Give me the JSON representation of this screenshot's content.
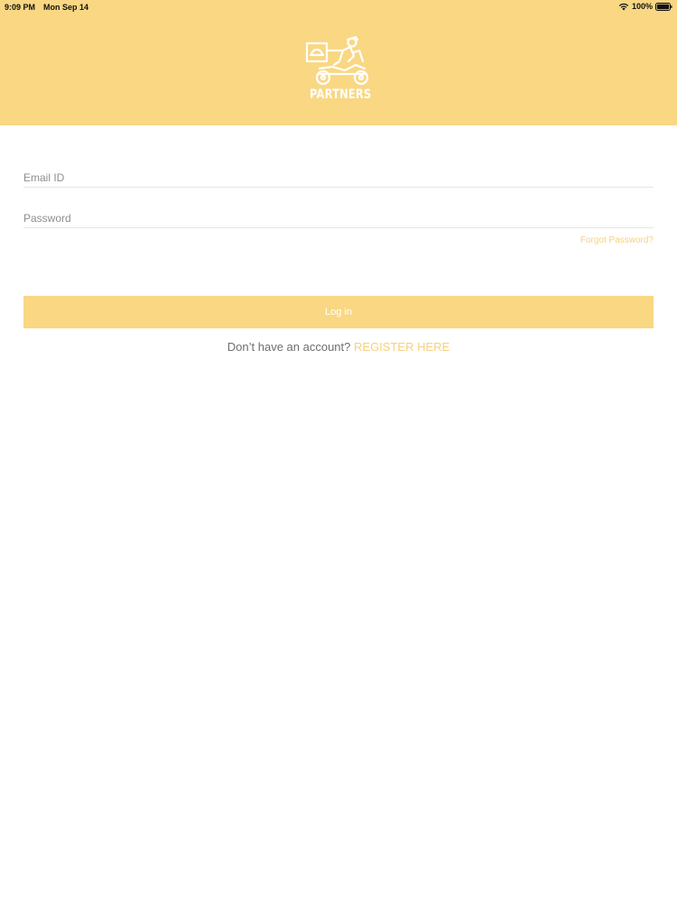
{
  "status_bar": {
    "time": "9:09 PM",
    "date": "Mon Sep 14",
    "battery": "100%",
    "icons": [
      "wifi-icon",
      "battery-icon"
    ]
  },
  "header": {
    "logo_text": "PARTNERS",
    "logo_icon": "delivery-scooter-icon",
    "background_color": "#f9d783"
  },
  "form": {
    "email_placeholder": "Email ID",
    "email_value": "",
    "password_placeholder": "Password",
    "password_value": "",
    "forgot_password": "Forgot Password?",
    "login_label": "Log in",
    "register_prompt": "Don’t have an account?",
    "register_link": "REGISTER HERE"
  },
  "colors": {
    "accent": "#f9d783",
    "link": "#f7d07b",
    "text_muted": "#8e8e8e"
  }
}
